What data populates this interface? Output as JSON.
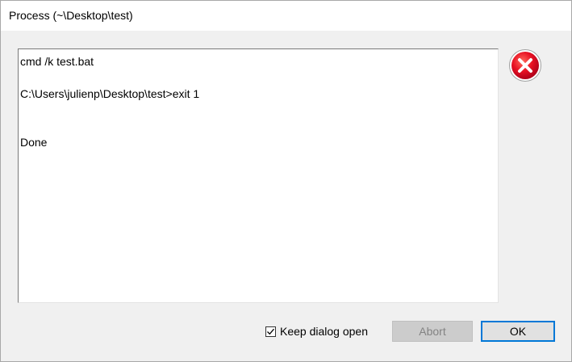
{
  "window": {
    "title": "Process (~\\Desktop\\test)"
  },
  "output": {
    "lines": [
      "cmd /k test.bat",
      "",
      "C:\\Users\\julienp\\Desktop\\test>exit 1",
      "",
      "",
      "Done"
    ]
  },
  "status": {
    "icon": "error-icon",
    "color": "#e81123"
  },
  "footer": {
    "keep_open_label": "Keep dialog open",
    "keep_open_checked": true,
    "abort_label": "Abort",
    "abort_enabled": false,
    "ok_label": "OK"
  },
  "colors": {
    "accent": "#0078d7",
    "error": "#e81123"
  }
}
